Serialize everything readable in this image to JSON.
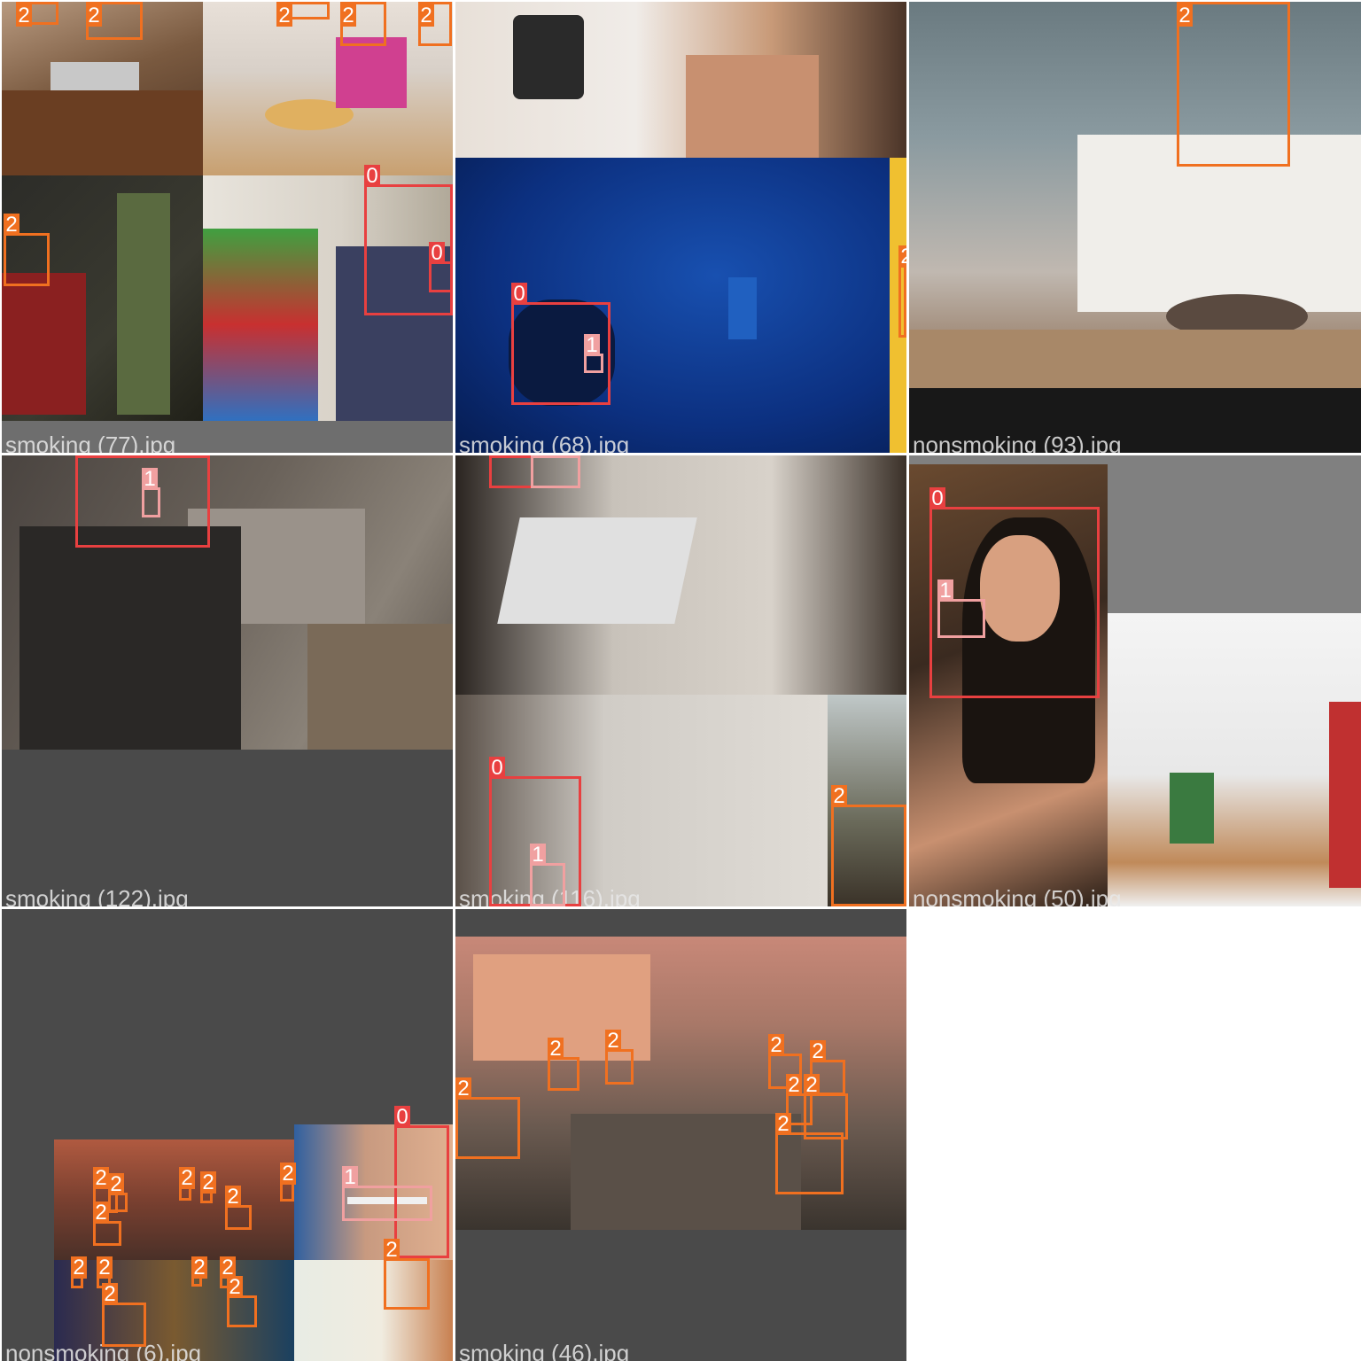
{
  "grid": {
    "tiles": [
      {
        "filename": "smoking (77).jpg"
      },
      {
        "filename": "smoking (68).jpg"
      },
      {
        "filename": "nonsmoking (93).jpg"
      },
      {
        "filename": "smoking (122).jpg"
      },
      {
        "filename": "smoking (116).jpg"
      },
      {
        "filename": "nonsmoking (50).jpg"
      },
      {
        "filename": "nonsmoking (6).jpg"
      },
      {
        "filename": "smoking (46).jpg"
      }
    ]
  },
  "class_labels": {
    "c0": "0",
    "c1": "1",
    "c2": "2"
  },
  "colors": {
    "class0": "#e84040",
    "class1": "#f0a0a0",
    "class2": "#f07020",
    "background": "#4a4a4a"
  }
}
